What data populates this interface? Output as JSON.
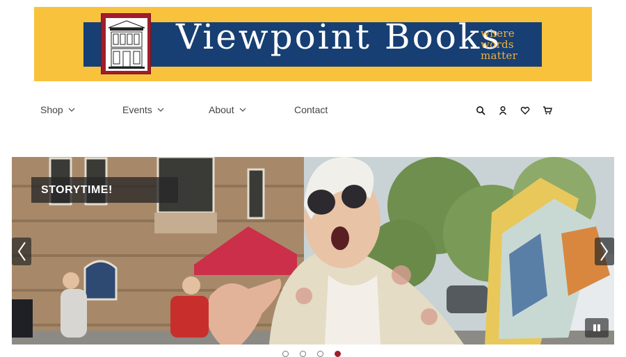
{
  "banner": {
    "brand_name": "Viewpoint Books",
    "tagline": [
      "where",
      "words",
      "matter"
    ],
    "colors": {
      "banner_bg": "#f9c23d",
      "inner_bg": "#173f73",
      "logo_bg": "#a11d2b",
      "tagline": "#f2b33d"
    }
  },
  "nav": {
    "items": [
      {
        "label": "Shop",
        "has_dropdown": true
      },
      {
        "label": "Events",
        "has_dropdown": true
      },
      {
        "label": "About",
        "has_dropdown": true
      },
      {
        "label": "Contact",
        "has_dropdown": false
      }
    ],
    "icons": [
      "search-icon",
      "account-icon",
      "wishlist-heart-icon",
      "cart-icon"
    ]
  },
  "hero": {
    "caption": "STORYTIME!",
    "prev_icon": "chevron-left-icon",
    "next_icon": "chevron-right-icon",
    "pause_icon": "pause-icon"
  },
  "carousel": {
    "slide_count": 4,
    "active_index": 3
  }
}
